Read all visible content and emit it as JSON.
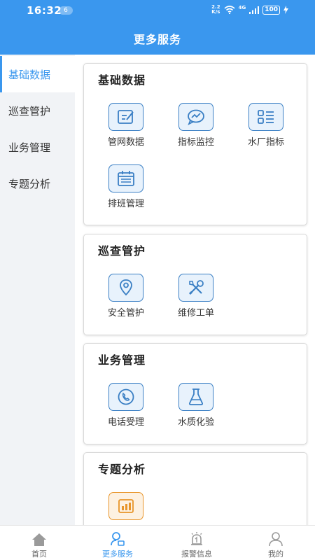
{
  "status_bar": {
    "time": "16:32",
    "notification_count": "6",
    "speed_top": "2.2",
    "speed_bottom": "K/s",
    "network": "4G",
    "battery": "100"
  },
  "header": {
    "title": "更多服务"
  },
  "sidebar": {
    "items": [
      {
        "label": "基础数据",
        "active": true
      },
      {
        "label": "巡查管护",
        "active": false
      },
      {
        "label": "业务管理",
        "active": false
      },
      {
        "label": "专题分析",
        "active": false
      }
    ]
  },
  "sections": [
    {
      "title": "基础数据",
      "items": [
        {
          "label": "管网数据",
          "icon": "edit-icon"
        },
        {
          "label": "指标监控",
          "icon": "chart-bubble-icon"
        },
        {
          "label": "水厂指标",
          "icon": "grid-list-icon"
        },
        {
          "label": "排班管理",
          "icon": "calendar-icon"
        }
      ]
    },
    {
      "title": "巡查管护",
      "items": [
        {
          "label": "安全管护",
          "icon": "location-pin-icon"
        },
        {
          "label": "维修工单",
          "icon": "tools-icon"
        }
      ]
    },
    {
      "title": "业务管理",
      "items": [
        {
          "label": "电话受理",
          "icon": "phone-icon"
        },
        {
          "label": "水质化验",
          "icon": "flask-icon"
        }
      ]
    },
    {
      "title": "专题分析",
      "items": [
        {
          "label": "",
          "icon": "bar-chart-icon"
        }
      ]
    }
  ],
  "tabbar": {
    "items": [
      {
        "label": "首页",
        "icon": "home-icon",
        "active": false
      },
      {
        "label": "更多服务",
        "icon": "service-icon",
        "active": true
      },
      {
        "label": "报警信息",
        "icon": "alarm-icon",
        "active": false
      },
      {
        "label": "我的",
        "icon": "user-icon",
        "active": false
      }
    ]
  },
  "colors": {
    "primary": "#3a97ee",
    "icon_border": "#3a7fc4",
    "icon_fill": "#e8f2fc",
    "orange": "#e8952a"
  }
}
